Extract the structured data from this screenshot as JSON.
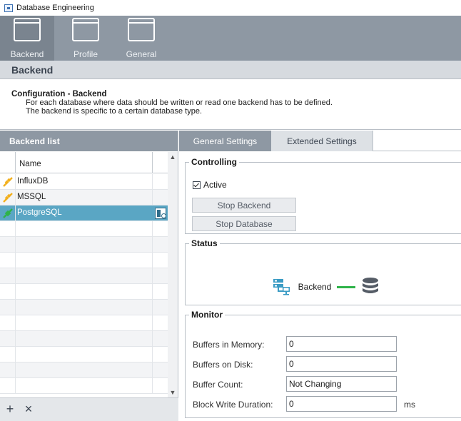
{
  "window": {
    "title": "Database Engineering"
  },
  "nav": {
    "items": [
      {
        "label": "Backend",
        "active": true
      },
      {
        "label": "Profile",
        "active": false
      },
      {
        "label": "General",
        "active": false
      }
    ]
  },
  "section": {
    "title": "Backend"
  },
  "description": {
    "title": "Configuration - Backend",
    "line1": "For each database where data should be written or read one backend has to be defined.",
    "line2": "The backend is specific to a certain database type."
  },
  "backend_list": {
    "header": "Backend list",
    "column_name": "Name",
    "rows": [
      {
        "name": "InfluxDB",
        "status_icon": "plug-disconnected-icon",
        "status_color": "#f2b01e"
      },
      {
        "name": "MSSQL",
        "status_icon": "plug-disconnected-icon",
        "status_color": "#f2b01e"
      },
      {
        "name": "PostgreSQL",
        "status_icon": "plug-connected-icon",
        "status_color": "#2fb34a",
        "selected": true
      }
    ],
    "footer": {
      "add_label": "+",
      "remove_label": "×"
    }
  },
  "tabs": [
    {
      "label": "General Settings",
      "active": true
    },
    {
      "label": "Extended Settings",
      "active": false
    }
  ],
  "controlling": {
    "legend": "Controlling",
    "active_label": "Active",
    "active_checked": true,
    "stop_backend_label": "Stop Backend",
    "stop_database_label": "Stop Database"
  },
  "status": {
    "legend": "Status",
    "backend_label": "Backend",
    "connection_color": "#2fb34a"
  },
  "monitor": {
    "legend": "Monitor",
    "fields": [
      {
        "label": "Buffers in Memory:",
        "value": "0",
        "unit": ""
      },
      {
        "label": "Buffers on Disk:",
        "value": "0",
        "unit": ""
      },
      {
        "label": "Buffer Count:",
        "value": "Not Changing",
        "unit": ""
      },
      {
        "label": "Block Write Duration:",
        "value": "0",
        "unit": "ms"
      }
    ]
  },
  "colors": {
    "toolbar": "#8e98a3",
    "selected_row": "#5aa6c4",
    "warning": "#f2b01e",
    "ok": "#2fb34a"
  }
}
